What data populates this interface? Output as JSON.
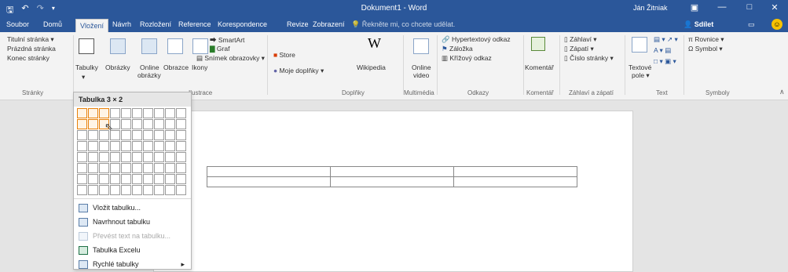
{
  "title_bar": {
    "document_title": "Dokument1 - Word",
    "user_name": "Ján Žitniak",
    "save_icon": "save-icon",
    "undo_icon": "undo-icon",
    "redo_icon": "redo-icon",
    "customize_icon": "chevron-down-icon",
    "ribbon_display_icon": "ribbon-display-icon",
    "minimize_icon": "minimize-icon",
    "maximize_icon": "maximize-icon",
    "close_icon": "close-icon"
  },
  "tabs": [
    {
      "label": "Soubor"
    },
    {
      "label": "Domů"
    },
    {
      "label": "Vložení"
    },
    {
      "label": "Návrh"
    },
    {
      "label": "Rozložení"
    },
    {
      "label": "Reference"
    },
    {
      "label": "Korespondence"
    },
    {
      "label": "Revize"
    },
    {
      "label": "Zobrazení"
    }
  ],
  "tell_me": "Řekněte mi, co chcete udělat.",
  "share": "Sdílet",
  "ribbon": {
    "pages": {
      "items": [
        "Titulní stránka ▾",
        "Prázdná stránka",
        "Konec stránky"
      ],
      "label": "Stránky"
    },
    "tables": {
      "button": "Tabulky"
    },
    "illustrations": {
      "label": "Ilustrace",
      "pictures": "Obrázky",
      "online_line1": "Online",
      "online_line2": "obrázky",
      "shapes": "Obrazce",
      "icons": "Ikony",
      "smartart": "SmartArt",
      "graph": "Graf",
      "screenshot": "Snímek obrazovky ▾"
    },
    "addins": {
      "label": "Doplňky",
      "store": "Store",
      "my_addins": "Moje doplňky ▾",
      "wikipedia": "Wikipedia",
      "wikipedia_glyph": "W"
    },
    "media": {
      "label": "Multimédia",
      "online_line1": "Online",
      "online_line2": "video"
    },
    "links": {
      "label": "Odkazy",
      "hyperlink": "Hypertextový odkaz",
      "bookmark": "Záložka",
      "crossref": "Křížový odkaz"
    },
    "comments": {
      "label": "Komentář",
      "button": "Komentář"
    },
    "header_footer": {
      "label": "Záhlaví a zápatí",
      "header": "Záhlaví ▾",
      "footer": "Zápatí ▾",
      "page_number": "Číslo stránky ▾"
    },
    "text": {
      "label": "Text",
      "textbox_line1": "Textové",
      "textbox_line2": "pole ▾"
    },
    "symbols": {
      "label": "Symboly",
      "equation": "π Rovnice ▾",
      "symbol": "Ω Symbol ▾"
    }
  },
  "table_dropdown": {
    "header": "Tabulka 3 × 2",
    "grid_cols": 10,
    "grid_rows": 8,
    "selected_cols": 3,
    "selected_rows": 2,
    "menu": [
      {
        "label": "Vložit tabulku...",
        "enabled": true
      },
      {
        "label": "Navrhnout tabulku",
        "enabled": true
      },
      {
        "label": "Převést text na tabulku...",
        "enabled": false
      },
      {
        "label": "Tabulka Excelu",
        "enabled": true
      },
      {
        "label": "Rychlé tabulky",
        "enabled": true,
        "submenu": true
      }
    ]
  },
  "document_table": {
    "rows": 2,
    "cols": 3
  },
  "colors": {
    "accent": "#2b579a",
    "ribbon_bg": "#f3f3f3",
    "grid_highlight": "#e8820c"
  }
}
